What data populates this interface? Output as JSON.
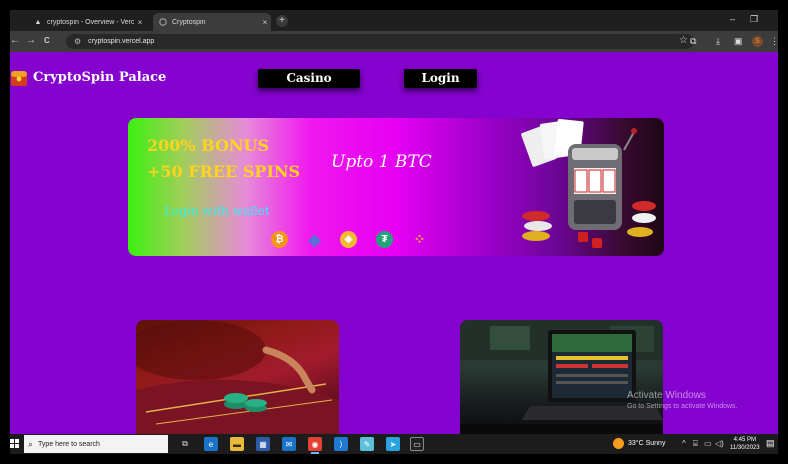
{
  "browser": {
    "tabs": [
      {
        "title": "cryptospin - Overview - Vercel",
        "active": false,
        "icon": "vercel-triangle-icon"
      },
      {
        "title": "Cryptospin",
        "active": true,
        "icon": "globe-icon"
      }
    ],
    "new_tab_symbol": "+",
    "close_symbol": "×",
    "window_controls": {
      "minimize": "–",
      "restore": "❐"
    },
    "address": "cryptospin.vercel.app",
    "nav": {
      "back": "←",
      "forward": "→",
      "reload": "C"
    },
    "profile_initial": "S"
  },
  "page": {
    "brand": "CryptoSpin Palace",
    "nav": {
      "casino": "Casino",
      "login": "Login"
    },
    "banner": {
      "line1": "200% BONUS",
      "line2": "+50 FREE SPINS",
      "tagline": "Upto 1 BTC",
      "wallet_cta": "Login with wallet",
      "coins": [
        {
          "name": "bitcoin",
          "color": "#f7931a",
          "symbol": "₿"
        },
        {
          "name": "ethereum",
          "color": "#5b6fd6",
          "symbol": "◆"
        },
        {
          "name": "bnb",
          "color": "#f3ba2f",
          "symbol": "◈"
        },
        {
          "name": "tether",
          "color": "#26a17b",
          "symbol": "₮"
        },
        {
          "name": "binance-chain",
          "color": "#f3ba2f",
          "symbol": "⁘"
        }
      ]
    },
    "background_color": "#8403ce",
    "cards": [
      {
        "name": "casino-table"
      },
      {
        "name": "sports-betting-laptop"
      }
    ]
  },
  "watermark": {
    "title": "Activate Windows",
    "subtitle": "Go to Settings to activate Windows."
  },
  "taskbar": {
    "search_placeholder": "Type here to search",
    "weather": {
      "temp": "33°C",
      "condition": "Sunny"
    },
    "time": "4:45 PM",
    "date": "11/30/2023"
  }
}
